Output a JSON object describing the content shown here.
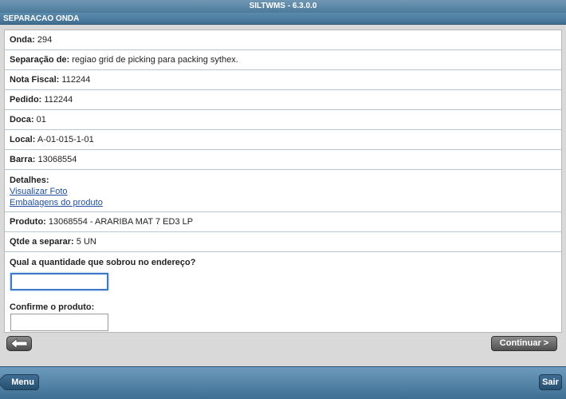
{
  "app": {
    "title": "SILTWMS - 6.3.0.0"
  },
  "page": {
    "title": "SEPARACAO ONDA"
  },
  "fields": [
    {
      "label": "Onda:",
      "value": "294"
    },
    {
      "label": "Separação de:",
      "value": "regiao grid de picking para packing sythex."
    },
    {
      "label": "Nota Fiscal:",
      "value": "112244"
    },
    {
      "label": "Pedido:",
      "value": "112244"
    },
    {
      "label": "Doca:",
      "value": "01"
    },
    {
      "label": "Local:",
      "value": "A-01-015-1-01"
    },
    {
      "label": "Barra:",
      "value": "13068554"
    }
  ],
  "details": {
    "label": "Detalhes:",
    "links": [
      "Visualizar Foto",
      "Embalagens do produto"
    ]
  },
  "fields2": [
    {
      "label": "Produto:",
      "value": "13068554 - ARARIBA MAT 7 ED3 LP"
    },
    {
      "label": "Qtde a separar:",
      "value": "5 UN"
    }
  ],
  "form": {
    "quantity_question": "Qual a quantidade que sobrou no endereço?",
    "quantity_value": "",
    "confirm_label": "Confirme o produto:",
    "confirm_value": ""
  },
  "actions": {
    "back_icon": "back-arrow-icon",
    "continue_label": "Continuar >"
  },
  "footer": {
    "menu_label": "Menu",
    "exit_label": "Sair"
  }
}
